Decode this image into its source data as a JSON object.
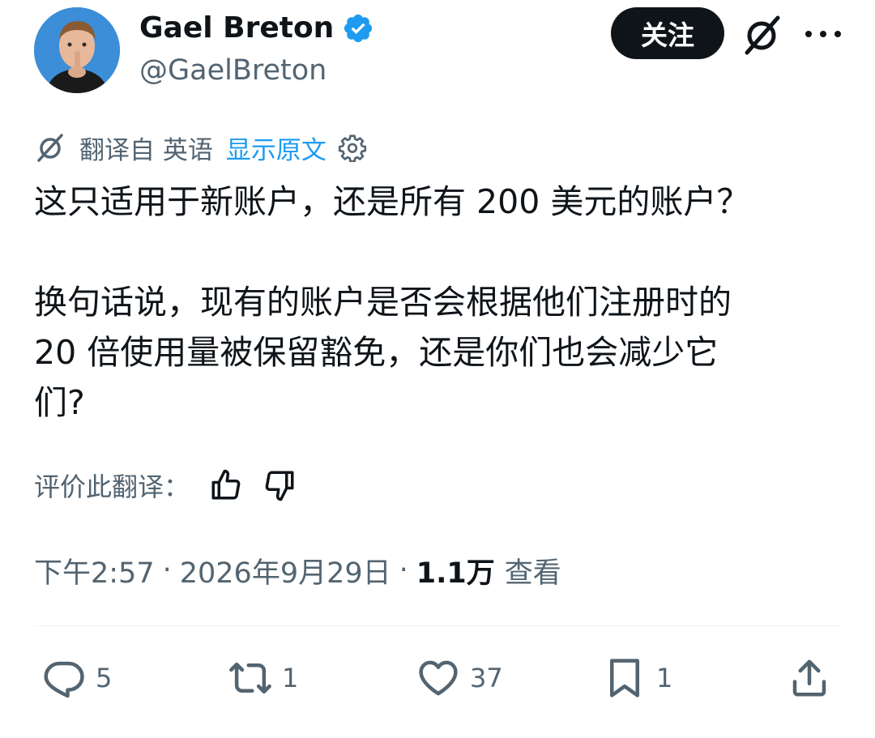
{
  "author": {
    "display_name": "Gael Breton",
    "handle": "@GaelBreton",
    "verified": true
  },
  "header": {
    "follow_label": "关注"
  },
  "translation": {
    "translated_from": "翻译自 英语",
    "show_original": "显示原文"
  },
  "tweet": {
    "text": "这只适用于新账户，还是所有 200 美元的账户？\n\n换句话说，现有的账户是否会根据他们注册时的\n20 倍使用量被保留豁免，还是你们也会减少它\n们?"
  },
  "rate_translation": {
    "label": "评价此翻译："
  },
  "meta": {
    "time": "下午2:57",
    "date": "2026年9月29日",
    "views_count": "1.1万",
    "views_label": "查看",
    "separator": "·"
  },
  "actions": {
    "replies": "5",
    "retweets": "1",
    "likes": "37",
    "bookmarks": "1"
  },
  "colors": {
    "text": "#0f1419",
    "secondary": "#536471",
    "link": "#1d9bf0",
    "verified": "#1d9bf0",
    "follow_bg": "#0f1419"
  },
  "icons": {
    "grok": "grok-icon",
    "more": "more-icon",
    "reply": "reply-icon",
    "retweet": "retweet-icon",
    "like": "heart-icon",
    "bookmark": "bookmark-icon",
    "share": "share-icon"
  }
}
